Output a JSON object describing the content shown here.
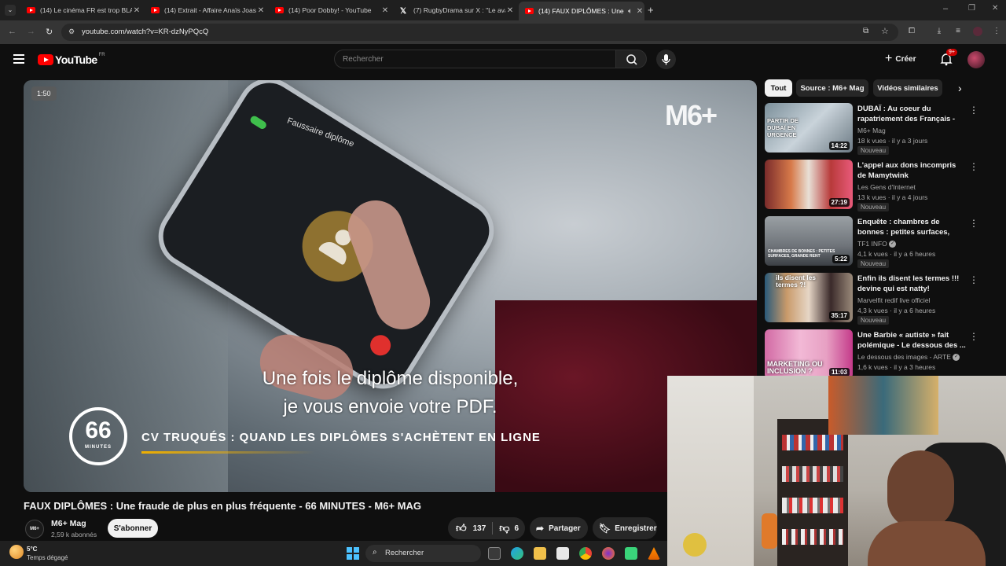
{
  "browser": {
    "tabs": [
      {
        "title": "(14) Le cinéma FR est trop BLAN"
      },
      {
        "title": "(14) Extrait - Affaire Anaïs Joas"
      },
      {
        "title": "(14) Poor Dobby! - YouTube"
      },
      {
        "title": "(7) RugbyDrama sur X : \"Le ava"
      },
      {
        "title": "(14) FAUX DIPLÔMES : Une"
      }
    ],
    "url": "youtube.com/watch?v=KR-dzNyPQcQ"
  },
  "youtube": {
    "logo_text": "YouTube",
    "region": "FR",
    "search_placeholder": "Rechercher",
    "create_label": "Créer",
    "notif_count": "9+"
  },
  "video": {
    "time_pill": "1:50",
    "subtitle_line1": "Une fois le diplôme disponible,",
    "subtitle_line2": "je vous envoie votre PDF.",
    "banner": "CV TRUQUÉS : QUAND LES DIPLÔMES S'ACHÈTENT EN LIGNE",
    "phone_caller": "Faussaire diplôme",
    "show_logo_number": "66",
    "show_logo_word": "MINUTES",
    "channel_logo": "M6+"
  },
  "details": {
    "title": "FAUX DIPLÔMES : Une fraude de plus en plus fréquente - 66 MINUTES - M6+ MAG",
    "channel": "M6+ Mag",
    "subscribers": "2,59 k abonnés",
    "subscribe_label": "S'abonner",
    "likes": "137",
    "dislikes": "6",
    "share_label": "Partager",
    "save_label": "Enregistrer"
  },
  "chips": [
    "Tout",
    "Source : M6+ Mag",
    "Vidéos similaires"
  ],
  "recommendations": [
    {
      "title": "DUBAÏ : Au coeur du rapatriement des Français - 66...",
      "channel": "M6+ Mag",
      "meta": "18 k vues · il y a 3 jours",
      "badge": "Nouveau",
      "duration": "14:22",
      "thumb_text": "PARTIR DE DUBAÏ EN URGENCE",
      "verified": false
    },
    {
      "title": "L'appel aux dons incompris de Mamytwink",
      "channel": "Les Gens d'Internet",
      "meta": "13 k vues · il y a 4 jours",
      "badge": "Nouveau",
      "duration": "27:19",
      "thumb_text": "",
      "verified": false
    },
    {
      "title": "Enquête : chambres de bonnes : petites surfaces, grande ...",
      "channel": "TF1 INFO",
      "meta": "4,1 k vues · il y a 6 heures",
      "badge": "Nouveau",
      "duration": "5:22",
      "thumb_text": "CHAMBRES DE BONNES : PETITES SURFACES, GRANDE RENT",
      "verified": true
    },
    {
      "title": "Enfin ils disent les termes !!! devine qui est natty!",
      "channel": "Marvelfit redif live officiel",
      "meta": "4,3 k vues · il y a 6 heures",
      "badge": "Nouveau",
      "duration": "35:17",
      "thumb_text": "ils disent les termes ?!",
      "verified": false
    },
    {
      "title": "Une Barbie « autiste » fait polémique - Le dessous des ...",
      "channel": "Le dessous des images - ARTE",
      "meta": "1,6 k vues · il y a 3 heures",
      "badge": "",
      "duration": "11:03",
      "thumb_text": "MARKETING OU INCLUSION ?",
      "verified": true
    }
  ],
  "taskbar": {
    "weather_temp": "5°C",
    "weather_desc": "Temps dégagé",
    "search_label": "Rechercher"
  }
}
